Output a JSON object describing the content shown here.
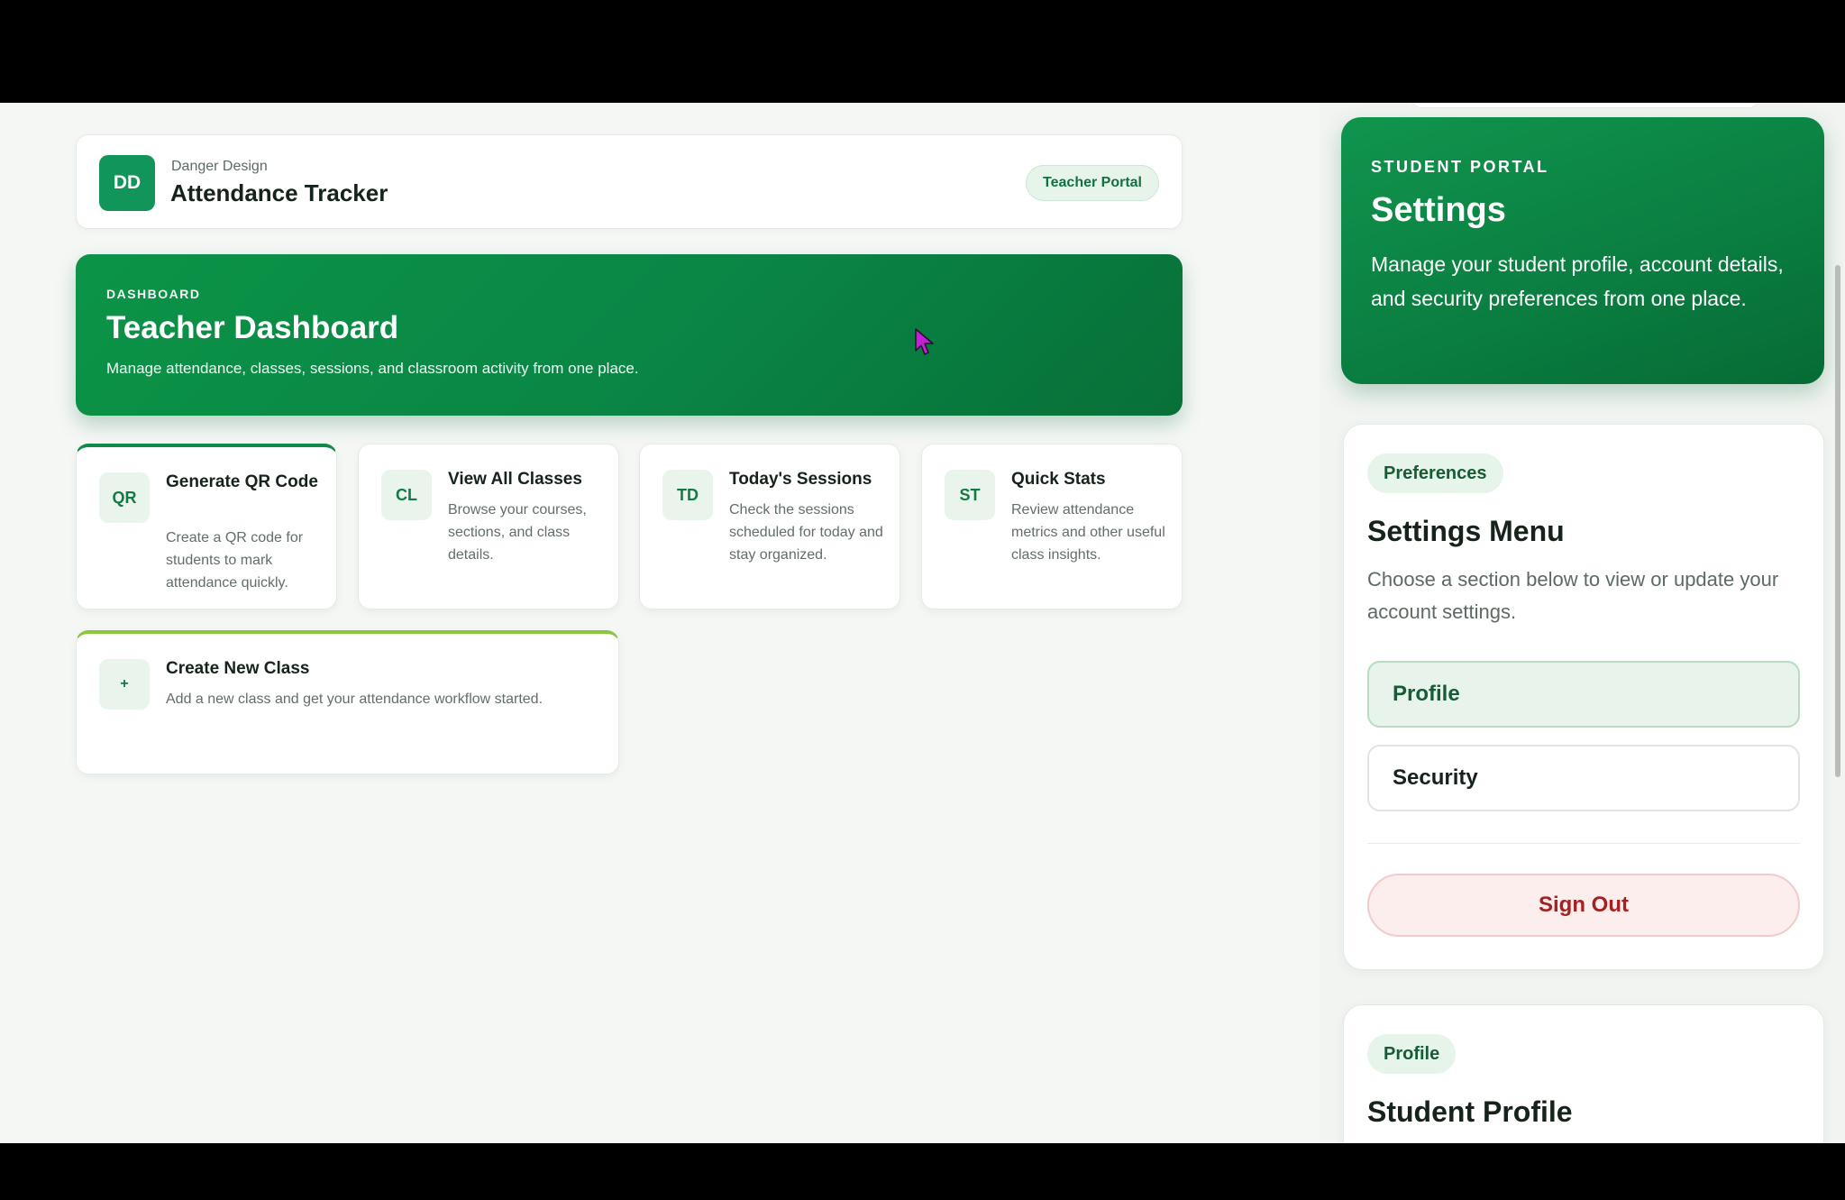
{
  "app": {
    "logo_initials": "DD",
    "brand_subtitle": "Danger Design",
    "brand_title": "Attendance Tracker",
    "portal_badge": "Teacher Portal"
  },
  "hero": {
    "eyebrow": "DASHBOARD",
    "title": "Teacher Dashboard",
    "description": "Manage attendance, classes, sessions, and classroom activity from one place."
  },
  "cards": [
    {
      "icon": "QR",
      "title": "Generate QR Code",
      "description": "Create a QR code for students to mark attendance quickly."
    },
    {
      "icon": "CL",
      "title": "View All Classes",
      "description": "Browse your courses, sections, and class details."
    },
    {
      "icon": "TD",
      "title": "Today's Sessions",
      "description": "Check the sessions scheduled for today and stay organized."
    },
    {
      "icon": "ST",
      "title": "Quick Stats",
      "description": "Review attendance metrics and other useful class insights."
    },
    {
      "icon": "+",
      "title": "Create New Class",
      "description": "Add a new class and get your attendance workflow started."
    }
  ],
  "settings_panel": {
    "eyebrow": "STUDENT PORTAL",
    "title": "Settings",
    "description": "Manage your student profile, account details, and security preferences from one place.",
    "menu": {
      "pill": "Preferences",
      "title": "Settings Menu",
      "description": "Choose a section below to view or update your account settings.",
      "items": [
        "Profile",
        "Security"
      ],
      "active_item": "Profile",
      "sign_out": "Sign Out"
    },
    "profile": {
      "pill": "Profile",
      "title": "Student Profile"
    }
  },
  "colors": {
    "primary_green": "#0a8545",
    "accent_lime": "#8cc63f",
    "danger": "#a52020",
    "cursor": "#c21fd6"
  }
}
